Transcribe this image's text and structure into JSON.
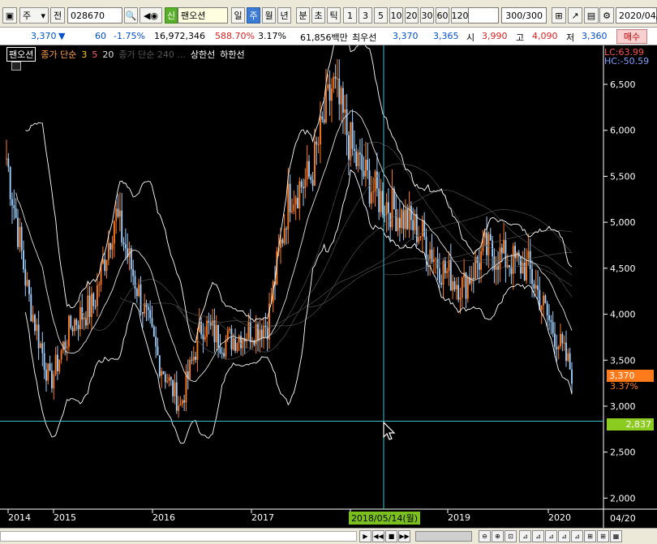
{
  "toolbar": {
    "period_select": "주",
    "mode_label": "전",
    "code": "028670",
    "credit_badge": "신",
    "stock_name": "팬오션",
    "period_tabs": [
      "일",
      "주",
      "월",
      "년",
      "분",
      "초",
      "틱"
    ],
    "active_period": "주",
    "intervals": [
      "1",
      "3",
      "5",
      "10",
      "20",
      "30",
      "60",
      "120"
    ],
    "count": "300/300",
    "date": "2020/04/"
  },
  "quote": {
    "price": "3,370",
    "direction": "▼",
    "change": "60",
    "change_pct": "-1.75%",
    "volume": "16,972,346",
    "volume_ratio": "588.70%",
    "turnover": "3.17%",
    "amount": "61,856백만",
    "best_label": "최우선",
    "ask": "3,370",
    "bid": "3,365",
    "open_label": "시",
    "open": "3,990",
    "high_label": "고",
    "high": "4,090",
    "low_label": "저",
    "low": "3,360",
    "buy_button": "매수"
  },
  "legend": {
    "name": "팬오션",
    "ma_label": "종가 단순",
    "ma_periods": [
      "3",
      "5",
      "20"
    ],
    "ma_hidden": "종가 단순 240 ...",
    "upper": "상한선",
    "lower": "하한선"
  },
  "corner": {
    "lc": "LC:63.99",
    "hc": "HC:-50.59"
  },
  "right_tags": {
    "current": "3,370",
    "current_pct": "3.37%",
    "cursor_price": "2,837"
  },
  "bottom": {
    "cursor_date": "2018/05/14(월)",
    "end_label": "04/20"
  },
  "colors": {
    "up": "#ff7a1a",
    "down": "#9fd0ff",
    "accent_green": "#7cc020"
  },
  "chart_data": {
    "type": "line",
    "y_ticks": [
      "6,500",
      "6,000",
      "5,500",
      "5,000",
      "4,500",
      "4,000",
      "3,500",
      "3,000",
      "2,500",
      "2,000"
    ],
    "ylim": [
      1880,
      6800
    ],
    "x_labels": [
      "2014",
      "2015",
      "2016",
      "2017",
      "2018/05/14(월)",
      "2019",
      "2020",
      "04/20"
    ],
    "series": [
      {
        "name": "종가",
        "x": [
          "2014-01",
          "2014-04",
          "2014-07",
          "2014-10",
          "2015-01",
          "2015-04",
          "2015-07",
          "2015-10",
          "2016-01",
          "2016-04",
          "2016-07",
          "2016-10",
          "2017-01",
          "2017-04",
          "2017-07",
          "2017-10",
          "2018-01",
          "2018-04",
          "2018-07",
          "2018-10",
          "2019-01",
          "2019-04",
          "2019-07",
          "2019-10",
          "2020-01",
          "2020-03",
          "2020-04"
        ],
        "values": [
          5700,
          4200,
          3250,
          3900,
          4100,
          5100,
          4300,
          3500,
          3000,
          3900,
          3700,
          3800,
          3900,
          5300,
          5500,
          6500,
          5700,
          5300,
          5100,
          4900,
          4500,
          4300,
          4700,
          4600,
          4500,
          3900,
          3370
        ]
      }
    ]
  }
}
